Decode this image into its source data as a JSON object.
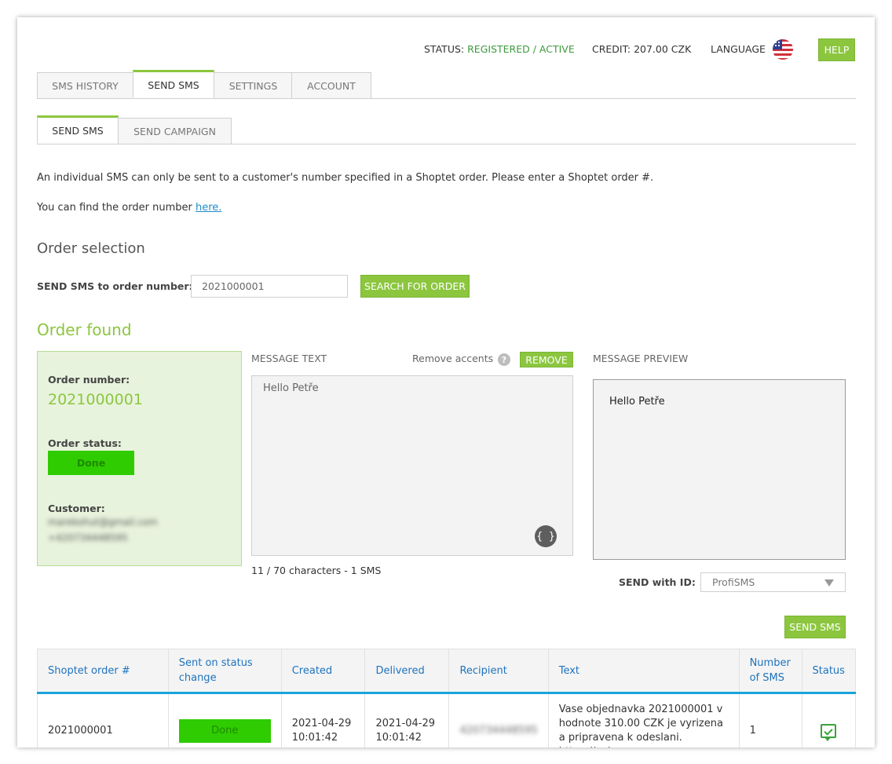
{
  "header": {
    "status_label": "STATUS:",
    "status_value": "REGISTERED / ACTIVE",
    "credit": "CREDIT: 207.00 CZK",
    "language_label": "LANGUAGE",
    "help_label": "HELP"
  },
  "main_tabs": [
    {
      "label": "SMS HISTORY",
      "active": false
    },
    {
      "label": "SEND SMS",
      "active": true
    },
    {
      "label": "SETTINGS",
      "active": false
    },
    {
      "label": "ACCOUNT",
      "active": false
    }
  ],
  "sub_tabs": [
    {
      "label": "SEND SMS",
      "active": true
    },
    {
      "label": "SEND CAMPAIGN",
      "active": false
    }
  ],
  "intro": {
    "line1": "An individual SMS can only be sent to a customer's number specified in a Shoptet order. Please enter a Shoptet order #.",
    "line2_prefix": "You can find the order number ",
    "line2_link": "here."
  },
  "order_selection": {
    "title": "Order selection",
    "field_label": "SEND SMS to order number:",
    "field_value": "2021000001",
    "search_button": "SEARCH FOR ORDER"
  },
  "order_found": {
    "title": "Order found",
    "order_number_label": "Order number:",
    "order_number": "2021000001",
    "order_status_label": "Order status:",
    "order_status": "Done",
    "customer_label": "Customer:",
    "customer_email": "marekohut@gmail.com",
    "customer_phone": "+420734448595"
  },
  "message": {
    "text_label": "MESSAGE TEXT",
    "remove_accents_label": "Remove accents",
    "remove_button": "REMOVE",
    "text_value": "Hello Petře",
    "counter": "11 / 70 characters - 1 SMS",
    "braces_icon": "{ }"
  },
  "preview": {
    "label": "MESSAGE PREVIEW",
    "text": "Hello Petře",
    "send_id_label": "SEND with ID:",
    "send_id_value": "ProfiSMS",
    "send_button": "SEND SMS"
  },
  "table": {
    "headers": [
      "Shoptet order #",
      "Sent on status change",
      "Created",
      "Delivered",
      "Recipient",
      "Text",
      "Number of SMS",
      "Status"
    ],
    "rows": [
      {
        "order": "2021000001",
        "status_change": "Done",
        "created": "2021-04-29 10:01:42",
        "delivered": "2021-04-29 10:01:42",
        "recipient": "420734448595",
        "text": "Vase objednavka 2021000001 v hodnote 310.00 CZK je vyrizena a pripravena k odeslani. https://axima-",
        "count": "1",
        "status_icon": "message-check-icon"
      }
    ]
  },
  "colors": {
    "accent_green": "#8cc63f",
    "done_green": "#2ecc00",
    "link_blue": "#1e8cc8",
    "table_header_blue": "#1e73be"
  }
}
